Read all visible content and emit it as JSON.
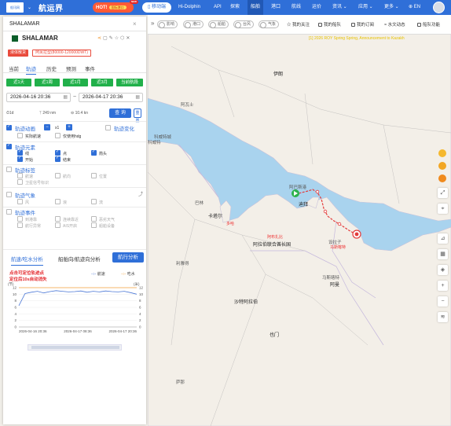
{
  "topbar": {
    "logo_text": "船讯网",
    "brand": "航运界",
    "promo_label": "HOT!",
    "promo_sub": "国际港口",
    "promo_new": "NEW",
    "mobile_label": "移动端",
    "nav_items": [
      "Hi-Dolphin",
      "API",
      "探索",
      "船舶",
      "港口",
      "航线",
      "运价",
      "资讯 ⌄",
      "应用 ⌄",
      "更多 ⌄",
      "⊕ EN"
    ],
    "active_nav": "船舶"
  },
  "map_toolbar": {
    "toggles": [
      "影响",
      "港口",
      "船舶",
      "台风",
      "气象"
    ],
    "items": [
      "我的关注",
      "我的船队",
      "我的订阅",
      "水文动态",
      "船队功能"
    ],
    "banner": "[1] 2026 ROY Spring Spring, Announcement to Kazakh"
  },
  "map": {
    "labels": {
      "iran": "伊朗",
      "ahvaz": "阿瓦士",
      "kuwait_city": "科威特城",
      "kuwait": "科威特",
      "bahrain": "巴林",
      "qatar": "卡塔尔",
      "doha": "多哈",
      "uae": "阿拉伯联合酋长国",
      "oman": "阿曼",
      "muscat": "马斯喀特",
      "riyadh": "利雅得",
      "saudi": "沙特阿拉伯",
      "bandar": "阿巴斯港",
      "abu_dhabi": "阿布扎比",
      "dubai": "迪拜",
      "shiraz": "设拉子",
      "yemen": "也门",
      "sanaa": "萨那",
      "marker": "马斯喀特"
    }
  },
  "panel": {
    "search_value": "SHALAMAR",
    "ship_name": "SHALAMAR",
    "tags": [
      "液体散货",
      "阿芙拉型(80000-120000DWT)"
    ],
    "tabs": [
      "当前",
      "轨迹",
      "历史",
      "预测",
      "事件"
    ],
    "active_tab": "轨迹",
    "quick_ranges": [
      "近1天",
      "近1周",
      "近1月",
      "近3月",
      "当前航段"
    ],
    "date_from": "2026-04-16 20:36",
    "date_to": "2026-04-17 20:36",
    "stats": {
      "days": "1d",
      "distance": "249 nm",
      "speed": "10.4 kn"
    },
    "query_label": "查 询",
    "reset_label": "重置",
    "track_anim": {
      "label": "轨迹动画",
      "speed": "x1"
    },
    "track_change_label": "轨迹变化",
    "anim_opts": [
      "实际航速",
      "仅使用hdg"
    ],
    "track_elements": {
      "label": "轨迹元素",
      "opts": [
        "线",
        "点",
        "箭头",
        "开始",
        "结束"
      ]
    },
    "track_tags": {
      "label": "轨迹标签",
      "opts": [
        "航速",
        "航向",
        "位置",
        "卫星信号标识"
      ]
    },
    "track_weather": {
      "label": "轨迹气象",
      "opts": [
        "风",
        "浪",
        "流"
      ]
    },
    "track_events": {
      "label": "轨迹事件",
      "opts": [
        "到港靠",
        "连续靠近",
        "恶劣天气",
        "航行异常",
        "AIS开启",
        "船舶设备"
      ]
    },
    "bottom_tabs": [
      "航速/吃水分析",
      "船舶向/航迹向分析"
    ],
    "voyage_btn": "航行分析",
    "note_line1": "点击可定位轨迹点",
    "note_line2": "定位后10s自动消失",
    "legend_speed": "航速",
    "legend_draft": "吃水"
  },
  "chart_data": {
    "type": "line",
    "x": [
      "2026-04-16 20:36",
      "2026-04-17 08:36",
      "2026-04-17 20:36"
    ],
    "ylabel_left": "(节)",
    "ylabel_right": "(米)",
    "ylim": [
      0,
      12
    ],
    "yticks": [
      0,
      2,
      4,
      6,
      8,
      10,
      12
    ],
    "series": [
      {
        "name": "航速",
        "color": "#4a77d6",
        "values": [
          6.5,
          10.2,
          10.6,
          10.9,
          10.4,
          10.8,
          11.1,
          10.9,
          10.7,
          10.8,
          11.0,
          10.6,
          10.9,
          10.7,
          11.0,
          10.8,
          10.7,
          10.9,
          10.5,
          10.0
        ]
      },
      {
        "name": "吃水",
        "color": "#f5a23d",
        "values": [
          12,
          12,
          12,
          12,
          12,
          12,
          12,
          12,
          12,
          12,
          12,
          12,
          12,
          12,
          12,
          12,
          12,
          12,
          12,
          12
        ]
      }
    ]
  }
}
